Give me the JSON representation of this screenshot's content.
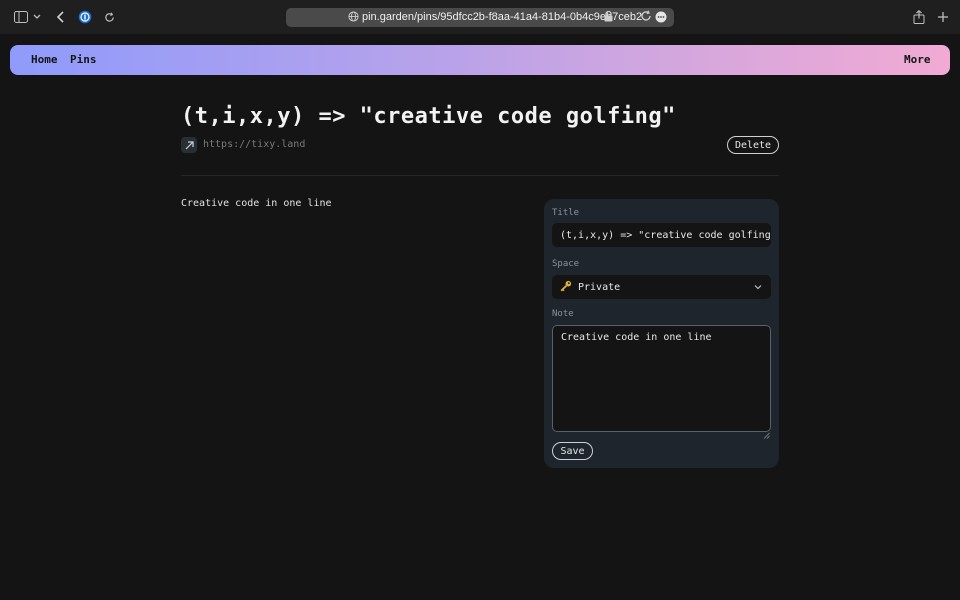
{
  "browser": {
    "url": "pin.garden/pins/95dfcc2b-f8aa-41a4-81b4-0b4c9eb7ceb2",
    "icons": [
      "sidebar-icon",
      "chevron-down-icon",
      "back-icon",
      "password-manager-icon",
      "reload-icon",
      "globe-icon",
      "lock-icon",
      "extension-icon",
      "share-icon",
      "new-tab-icon"
    ]
  },
  "nav": {
    "home_label": "Home",
    "pins_label": "Pins",
    "more_label": "More",
    "gradient_start": "#8f9bfb",
    "gradient_end": "#f1aad4"
  },
  "pin": {
    "title": "(t,i,x,y) => \"creative code golfing\"",
    "link": "https://tixy.land",
    "delete_label": "Delete",
    "note": "Creative code in one line"
  },
  "edit_form": {
    "title_label": "Title",
    "title_value": "(t,i,x,y) => \"creative code golfing\"",
    "space_label": "Space",
    "space_value": "Private",
    "space_icon": "key-icon",
    "note_label": "Note",
    "note_value": "Creative code in one line",
    "save_label": "Save"
  }
}
